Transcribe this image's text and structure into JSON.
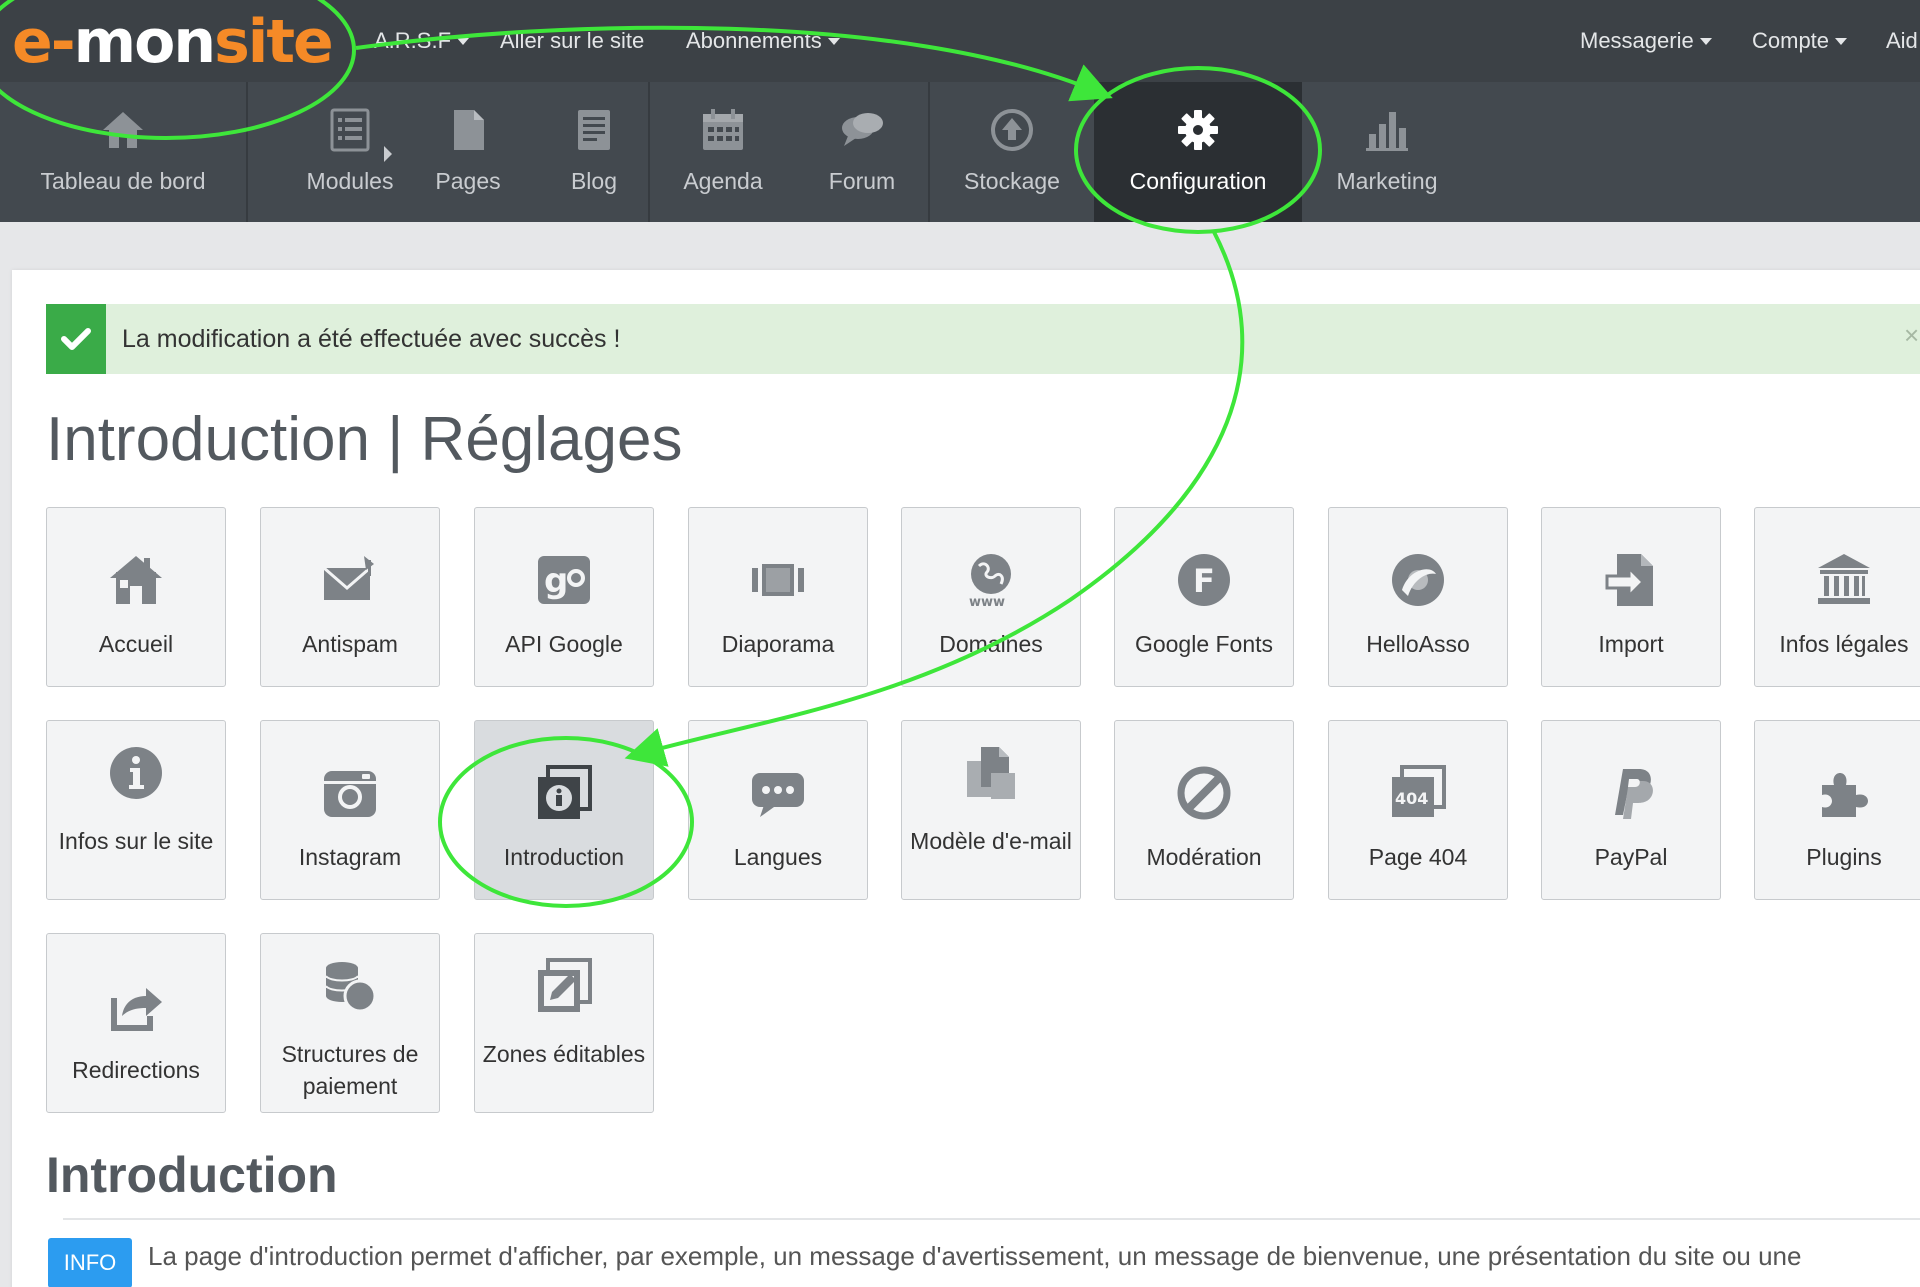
{
  "topbar": {
    "logo": {
      "e": "e-",
      "mon": "mon",
      "site": "site"
    },
    "links": [
      "A.R.S.F",
      "Aller sur le site",
      "Abonnements"
    ],
    "right_links": [
      "Messagerie",
      "Compte",
      "Aid"
    ]
  },
  "mainnav": {
    "items": [
      {
        "label": "Tableau de bord",
        "icon": "home-icon"
      },
      {
        "label": "Modules",
        "icon": "list-icon"
      },
      {
        "label": "Pages",
        "icon": "page-icon"
      },
      {
        "label": "Blog",
        "icon": "blog-icon"
      },
      {
        "label": "Agenda",
        "icon": "calendar-icon"
      },
      {
        "label": "Forum",
        "icon": "chat-icon"
      },
      {
        "label": "Stockage",
        "icon": "upload-icon"
      },
      {
        "label": "Configuration",
        "icon": "gear-icon",
        "active": true
      },
      {
        "label": "Marketing",
        "icon": "bar-chart-icon"
      }
    ]
  },
  "alert": {
    "message": "La modification a été effectuée avec succès !",
    "close": "×"
  },
  "page": {
    "title": "Introduction | Réglages",
    "subtitle": "Introduction"
  },
  "tiles": [
    {
      "label": "Accueil",
      "icon": "home-icon"
    },
    {
      "label": "Antispam",
      "icon": "envelope-icon"
    },
    {
      "label": "API Google",
      "icon": "google-icon"
    },
    {
      "label": "Diaporama",
      "icon": "slideshow-icon"
    },
    {
      "label": "Domaines",
      "icon": "globe-icon"
    },
    {
      "label": "Google Fonts",
      "icon": "font-icon"
    },
    {
      "label": "HelloAsso",
      "icon": "helloasso-icon"
    },
    {
      "label": "Import",
      "icon": "import-icon"
    },
    {
      "label": "Infos légales",
      "icon": "bank-icon"
    },
    {
      "label": "Infos sur le site",
      "icon": "info-icon"
    },
    {
      "label": "Instagram",
      "icon": "camera-icon"
    },
    {
      "label": "Introduction",
      "icon": "info-box-icon",
      "active": true
    },
    {
      "label": "Langues",
      "icon": "speech-icon"
    },
    {
      "label": "Modèle d'e-mail",
      "icon": "copy-icon"
    },
    {
      "label": "Modération",
      "icon": "ban-icon"
    },
    {
      "label": "Page 404",
      "icon": "page-404-icon"
    },
    {
      "label": "PayPal",
      "icon": "paypal-icon"
    },
    {
      "label": "Plugins",
      "icon": "puzzle-icon"
    },
    {
      "label": "Redirections",
      "icon": "share-icon"
    },
    {
      "label": "Structures de paiement",
      "icon": "coins-icon"
    },
    {
      "label": "Zones éditables",
      "icon": "edit-icon"
    }
  ],
  "info": {
    "badge": "INFO",
    "text": "La page d'introduction permet d'afficher, par exemple, un message d'avertissement, un message de bienvenue, une présentation du site ou une"
  },
  "colors": {
    "topbar": "#3c4146",
    "nav": "#43494f",
    "nav_active": "#2b2f33",
    "brand_orange": "#f58a27",
    "success_green": "#3aab48",
    "info_blue": "#2c9cf0",
    "annotation_green": "#3ee63a"
  }
}
